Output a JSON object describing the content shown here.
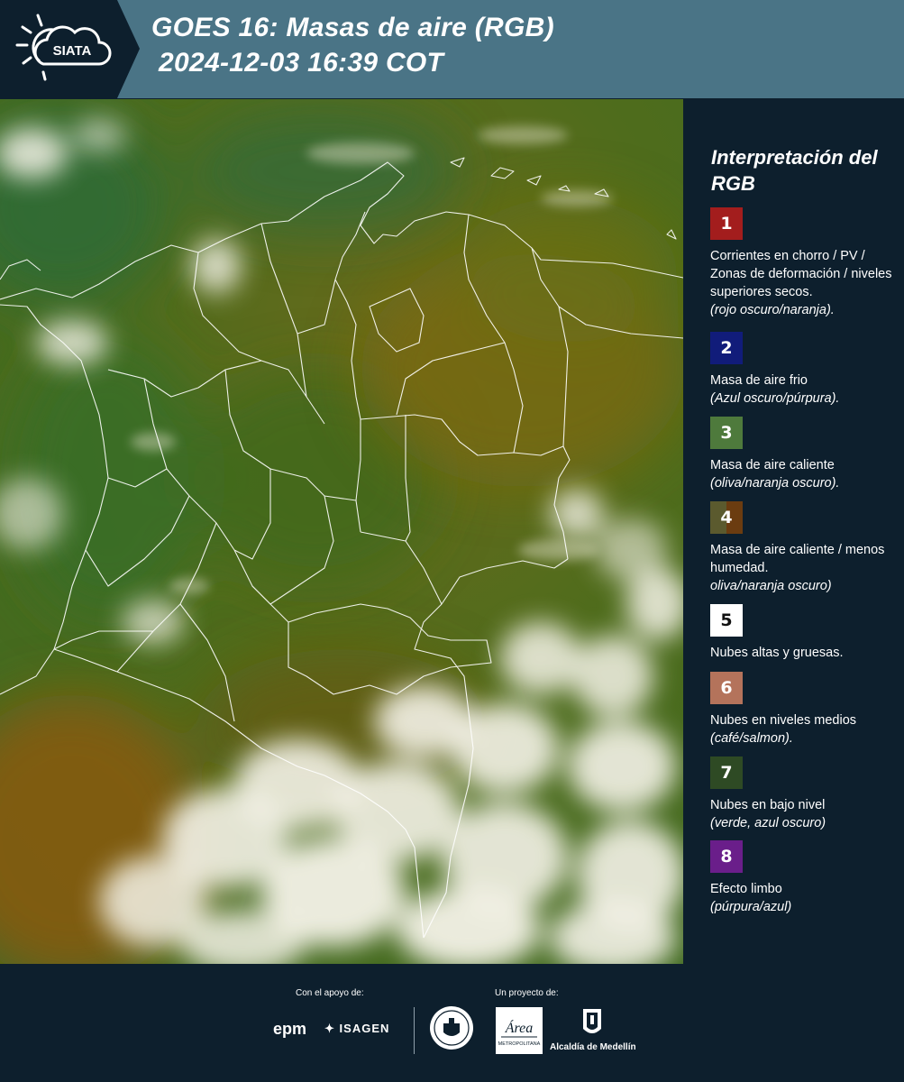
{
  "header": {
    "logo_text": "SIATA",
    "title_line1": "GOES 16: Masas de aire (RGB)",
    "title_line2": "2024-12-03 16:39 COT",
    "bg_color": "#4a7486"
  },
  "map": {
    "description_icon": "satellite-rgb-image",
    "boundary_color": "#ffffff"
  },
  "legend": {
    "title": "Interpretación del RGB",
    "items": [
      {
        "num": "1",
        "color": "#a31d1d",
        "desc": "Corrientes en chorro / PV / Zonas de deformación / niveles superiores secos.",
        "hint": "(rojo oscuro/naranja)."
      },
      {
        "num": "2",
        "color": "#111c7a",
        "desc": "Masa de aire frio",
        "hint": "(Azul oscuro/púrpura)."
      },
      {
        "num": "3",
        "color": "#4e7a3c",
        "desc": "Masa de aire caliente",
        "hint": "(oliva/naranja oscuro)."
      },
      {
        "num": "4",
        "color": "#5b5a2e",
        "color2": "#6b3c10",
        "desc": "Masa de aire caliente / menos humedad.",
        "hint": "oliva/naranja oscuro)"
      },
      {
        "num": "5",
        "color": "#ffffff",
        "desc": "Nubes altas y gruesas.",
        "hint": ""
      },
      {
        "num": "6",
        "color": "#b4735b",
        "desc": "Nubes en niveles medios",
        "hint": "(café/salmon)."
      },
      {
        "num": "7",
        "color": "#2e4a24",
        "desc": "Nubes en bajo nivel",
        "hint": "(verde, azul oscuro)"
      },
      {
        "num": "8",
        "color": "#6a1e8a",
        "desc": "Efecto limbo",
        "hint": "(púrpura/azul)"
      }
    ]
  },
  "footer": {
    "support_label": "Con el apoyo de:",
    "project_label": "Un proyecto de:",
    "epm": "epm",
    "isagen": "ISAGEN",
    "area_text": "Área",
    "area_sub": "METROPOLITANA",
    "alcaldia": "Alcaldía de Medellín"
  }
}
